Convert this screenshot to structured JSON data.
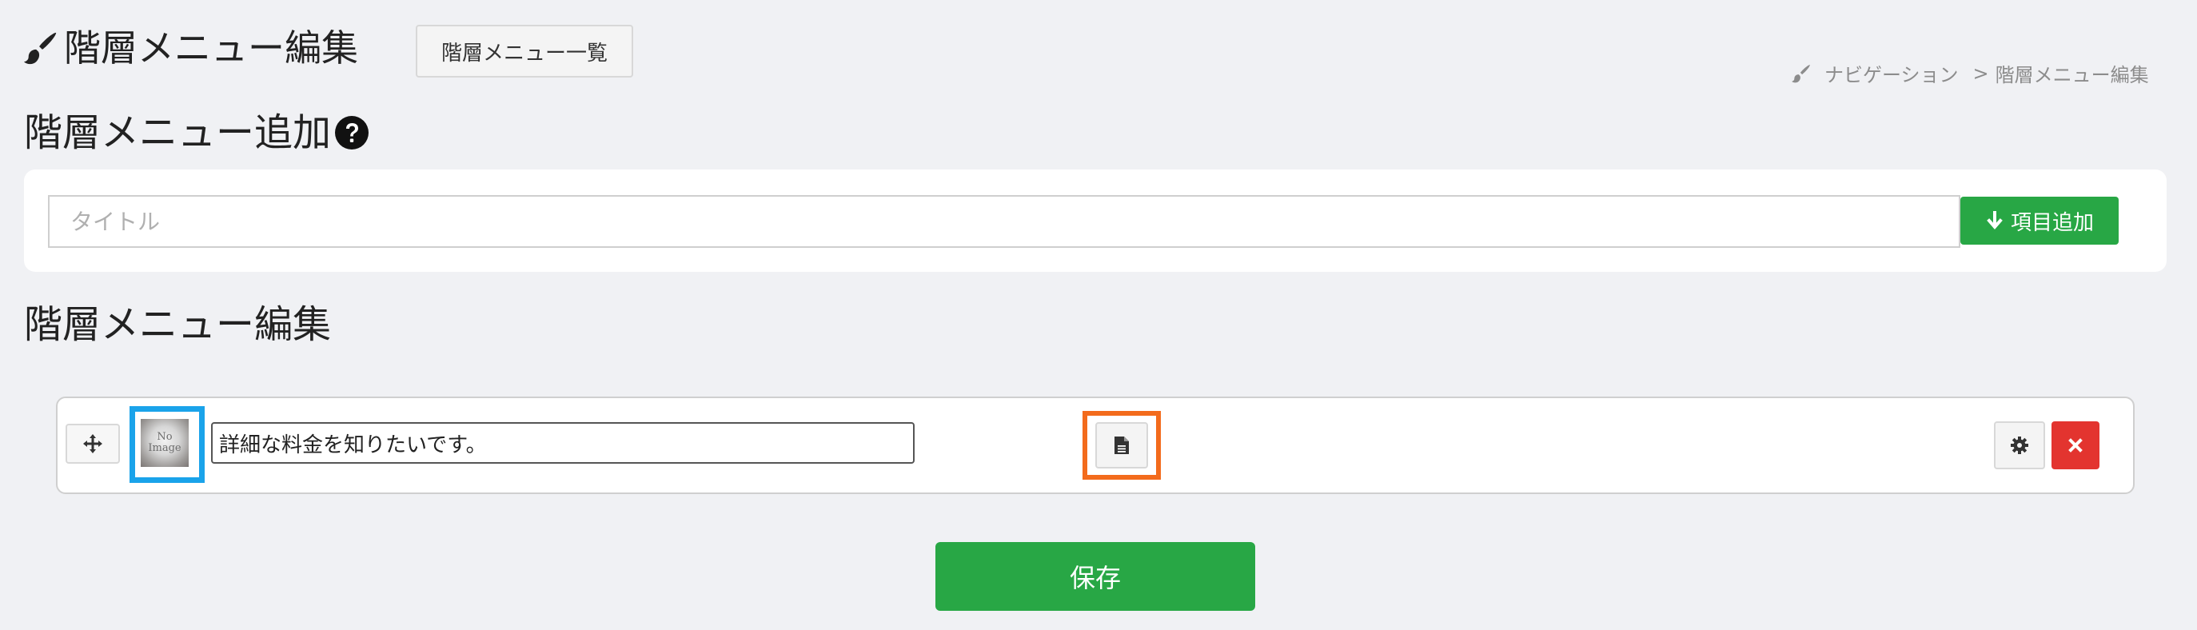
{
  "header": {
    "title": "階層メニュー編集",
    "list_button": "階層メニュー一覧",
    "brush_icon": "brush-icon"
  },
  "breadcrumb": {
    "items": [
      "ナビゲーション",
      "階層メニュー編集"
    ],
    "separator": ">"
  },
  "add_section": {
    "heading": "階層メニュー追加",
    "help_icon": "question-circle-icon",
    "title_placeholder": "タイトル",
    "add_button": "項目追加",
    "add_icon": "arrow-down-icon"
  },
  "edit_section": {
    "heading": "階層メニュー編集",
    "items": [
      {
        "thumbnail_text": [
          "No",
          "Image"
        ],
        "title": "詳細な料金を知りたいです。"
      }
    ]
  },
  "save_button": "保存",
  "colors": {
    "primary_green": "#28a745",
    "danger_red": "#e3342f",
    "highlight_blue": "#1aa3ea",
    "highlight_orange": "#f36b1c"
  }
}
